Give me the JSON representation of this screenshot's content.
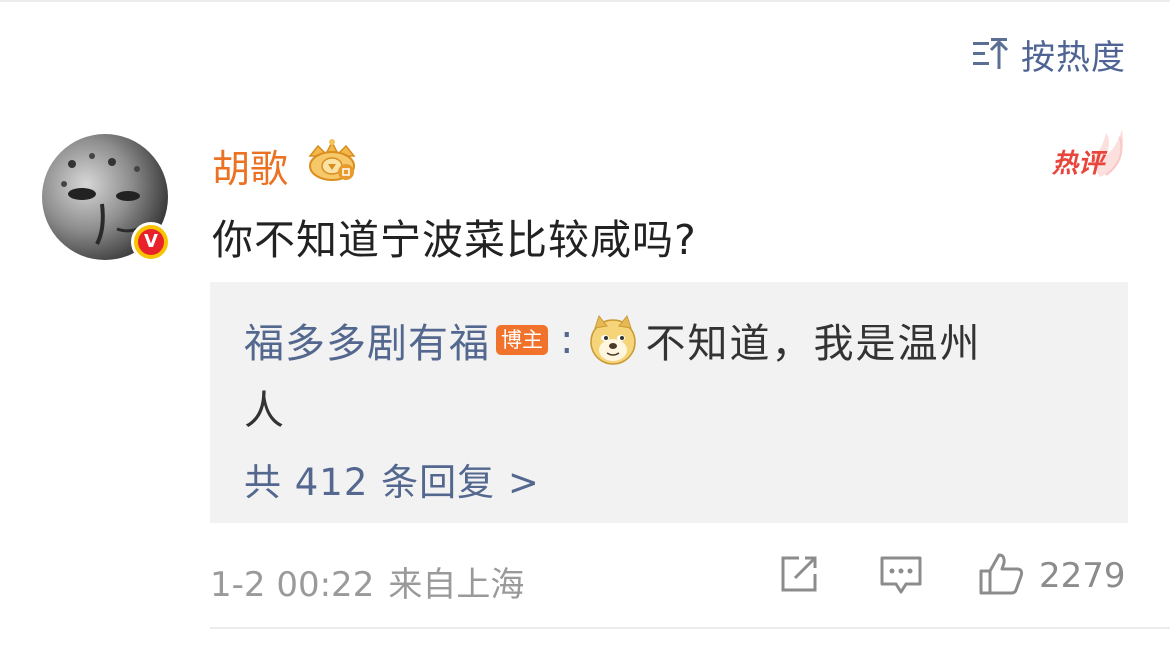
{
  "sort": {
    "label": "按热度",
    "icon": "sort-icon"
  },
  "comment": {
    "username": "胡歌",
    "badge_icon": "vip-crown-icon",
    "verified_icon": "verified-v-icon",
    "verified_letter": "V",
    "hot_label": "热评",
    "text": "你不知道宁波菜比较咸吗?",
    "time": "1-2 00:22",
    "source": "来自上海",
    "likes": "2279"
  },
  "reply": {
    "username": "福多多剧有福",
    "tag": "博主",
    "colon": ":",
    "emoji": "doge-emoji",
    "text_line1": "不知道，我是温州",
    "text_line2": "人",
    "more": "共 412 条回复 >"
  },
  "colors": {
    "username": "#ea7222",
    "link": "#53678f",
    "hot": "#e8453c",
    "tag": "#f0722b"
  }
}
